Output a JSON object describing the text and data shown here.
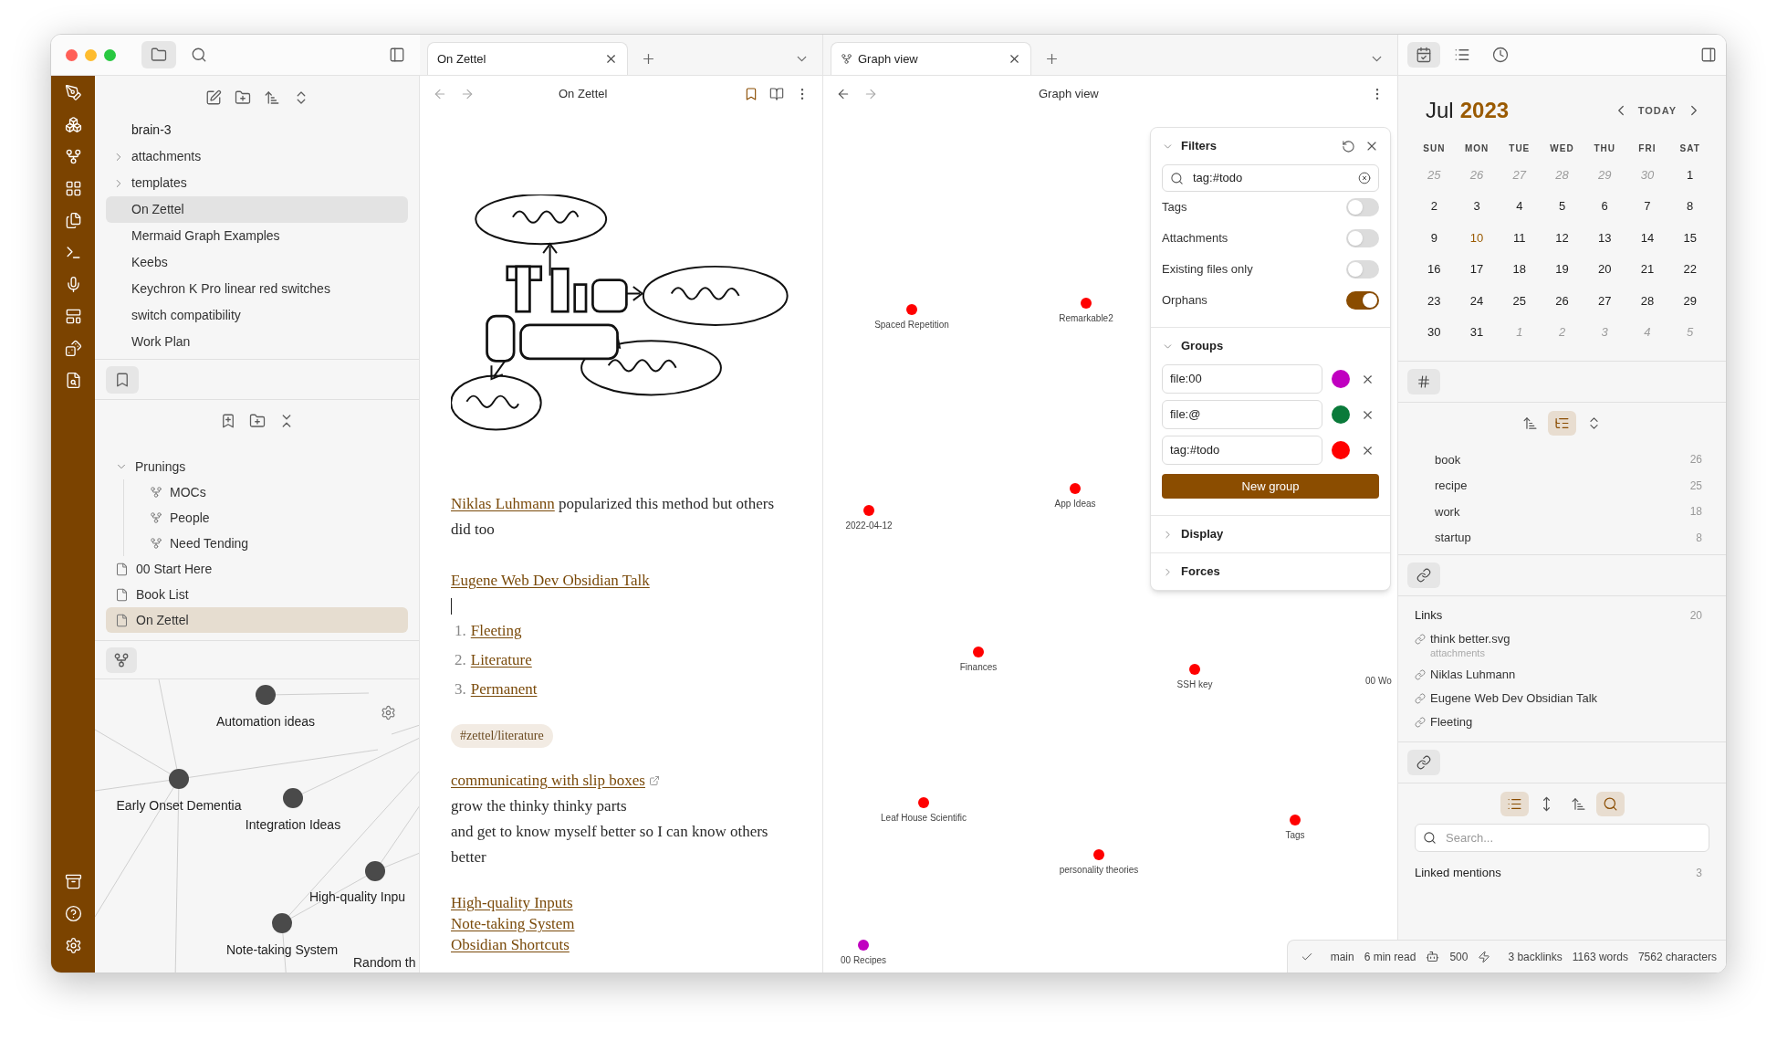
{
  "left_tabs": [
    {
      "kind": "files",
      "selected": true
    },
    {
      "kind": "search",
      "selected": false
    }
  ],
  "file_explorer": {
    "vault": "brain-3",
    "items": [
      {
        "label": "attachments",
        "kind": "folder",
        "selected": false
      },
      {
        "label": "templates",
        "kind": "folder",
        "selected": false
      },
      {
        "label": "On Zettel",
        "kind": "note",
        "selected": true
      },
      {
        "label": "Mermaid Graph Examples",
        "kind": "note",
        "selected": false
      },
      {
        "label": "Keebs",
        "kind": "note",
        "selected": false
      },
      {
        "label": "Keychron K Pro linear red switches",
        "kind": "note",
        "selected": false
      },
      {
        "label": "switch compatibility",
        "kind": "note",
        "selected": false
      },
      {
        "label": "Work Plan",
        "kind": "note",
        "selected": false
      }
    ]
  },
  "bookmarks": {
    "items": [
      {
        "label": "Prunings",
        "kind": "group",
        "selected": false,
        "expanded": true,
        "children": [
          {
            "label": "MOCs",
            "kind": "graph",
            "selected": false
          },
          {
            "label": "People",
            "kind": "graph",
            "selected": false
          },
          {
            "label": "Need Tending",
            "kind": "graph",
            "selected": false
          }
        ]
      },
      {
        "label": "00 Start Here",
        "kind": "note",
        "selected": false
      },
      {
        "label": "Book List",
        "kind": "note",
        "selected": false
      },
      {
        "label": "On Zettel",
        "kind": "note",
        "selected": true
      }
    ]
  },
  "local_graph": {
    "nodes": [
      {
        "label": "Automation ideas",
        "kind": "node"
      },
      {
        "label": "Early Onset Dementia",
        "kind": "node"
      },
      {
        "label": "Integration Ideas",
        "kind": "node"
      },
      {
        "label": "High-quality Inpu",
        "kind": "node"
      },
      {
        "label": "Note-taking System",
        "kind": "node"
      },
      {
        "label": "Random th",
        "kind": "label"
      }
    ]
  },
  "note": {
    "tab": "On Zettel",
    "title": "On Zettel",
    "blocks": [
      {
        "kind": "paragraph",
        "link": "Niklas Luhmann",
        "text": "popularized this method but others did too"
      },
      {
        "kind": "link",
        "text": "Eugene Web Dev Obsidian Talk"
      },
      {
        "kind": "cursor"
      },
      {
        "kind": "list",
        "items": [
          {
            "number": "1.",
            "text": "Fleeting"
          },
          {
            "number": "2.",
            "text": "Literature"
          },
          {
            "number": "3.",
            "text": "Permanent"
          }
        ]
      },
      {
        "kind": "tag",
        "text": "#zettel/literature"
      },
      {
        "kind": "external_link",
        "text": "communicating with slip boxes"
      },
      {
        "kind": "lines",
        "lines": [
          "grow the thinky thinky parts",
          "and get to know myself better so I can know others better"
        ]
      },
      {
        "kind": "links",
        "items": [
          "High-quality Inputs",
          "Note-taking System",
          "Obsidian Shortcuts"
        ]
      }
    ]
  },
  "graph": {
    "tab": "Graph view",
    "title": "Graph view",
    "nodes": [
      {
        "label": "Spaced Repetition",
        "color": "#ff0000"
      },
      {
        "label": "Remarkable2",
        "color": "#ff0000"
      },
      {
        "label": "App Ideas",
        "color": "#ff0000"
      },
      {
        "label": "2022-04-12",
        "color": "#ff0000"
      },
      {
        "label": "Finances",
        "color": "#ff0000"
      },
      {
        "label": "SSH key",
        "color": "#ff0000"
      },
      {
        "label": "00 Wo"
      },
      {
        "label": "Leaf House Scientific",
        "color": "#ff0000"
      },
      {
        "label": "Tags",
        "color": "#ff0000"
      },
      {
        "label": "personality theories",
        "color": "#ff0000"
      },
      {
        "label": "00 Recipes",
        "color": "#c000c0"
      }
    ],
    "filters": {
      "heading": {
        "label": "Filters",
        "expanded": true
      },
      "search": "tag:#todo",
      "toggles": [
        {
          "label": "Tags",
          "on": false
        },
        {
          "label": "Attachments",
          "on": false
        },
        {
          "label": "Existing files only",
          "on": false
        },
        {
          "label": "Orphans",
          "on": true
        }
      ],
      "groups_heading": {
        "label": "Groups",
        "expanded": true
      },
      "groups": [
        {
          "query": "file:00",
          "color": "#c000c0"
        },
        {
          "query": "file:@",
          "color": "#0a7a3a"
        },
        {
          "query": "tag:#todo",
          "color": "#ff0000"
        }
      ],
      "new_group": "New group",
      "sections": [
        {
          "label": "Display",
          "expanded": false
        },
        {
          "label": "Forces",
          "expanded": false
        }
      ]
    }
  },
  "right_tabs": [
    {
      "kind": "calendar",
      "selected": true
    },
    {
      "kind": "outline",
      "selected": false
    },
    {
      "kind": "recent",
      "selected": false
    }
  ],
  "calendar": {
    "month": "Jul",
    "year": "2023",
    "today_label": "TODAY",
    "weekdays": [
      "SUN",
      "MON",
      "TUE",
      "WED",
      "THU",
      "FRI",
      "SAT"
    ],
    "weeks": [
      [
        {
          "day": "25",
          "in_month": false,
          "today": false
        },
        {
          "day": "26",
          "in_month": false,
          "today": false
        },
        {
          "day": "27",
          "in_month": false,
          "today": false
        },
        {
          "day": "28",
          "in_month": false,
          "today": false
        },
        {
          "day": "29",
          "in_month": false,
          "today": false
        },
        {
          "day": "30",
          "in_month": false,
          "today": false
        },
        {
          "day": "1",
          "in_month": true,
          "today": false
        }
      ],
      [
        {
          "day": "2",
          "in_month": true,
          "today": false
        },
        {
          "day": "3",
          "in_month": true,
          "today": false
        },
        {
          "day": "4",
          "in_month": true,
          "today": false
        },
        {
          "day": "5",
          "in_month": true,
          "today": false
        },
        {
          "day": "6",
          "in_month": true,
          "today": false
        },
        {
          "day": "7",
          "in_month": true,
          "today": false
        },
        {
          "day": "8",
          "in_month": true,
          "today": false
        }
      ],
      [
        {
          "day": "9",
          "in_month": true,
          "today": false
        },
        {
          "day": "10",
          "in_month": true,
          "today": true
        },
        {
          "day": "11",
          "in_month": true,
          "today": false
        },
        {
          "day": "12",
          "in_month": true,
          "today": false
        },
        {
          "day": "13",
          "in_month": true,
          "today": false
        },
        {
          "day": "14",
          "in_month": true,
          "today": false
        },
        {
          "day": "15",
          "in_month": true,
          "today": false
        }
      ],
      [
        {
          "day": "16",
          "in_month": true,
          "today": false
        },
        {
          "day": "17",
          "in_month": true,
          "today": false
        },
        {
          "day": "18",
          "in_month": true,
          "today": false
        },
        {
          "day": "19",
          "in_month": true,
          "today": false
        },
        {
          "day": "20",
          "in_month": true,
          "today": false
        },
        {
          "day": "21",
          "in_month": true,
          "today": false
        },
        {
          "day": "22",
          "in_month": true,
          "today": false
        }
      ],
      [
        {
          "day": "23",
          "in_month": true,
          "today": false
        },
        {
          "day": "24",
          "in_month": true,
          "today": false
        },
        {
          "day": "25",
          "in_month": true,
          "today": false
        },
        {
          "day": "26",
          "in_month": true,
          "today": false
        },
        {
          "day": "27",
          "in_month": true,
          "today": false
        },
        {
          "day": "28",
          "in_month": true,
          "today": false
        },
        {
          "day": "29",
          "in_month": true,
          "today": false
        }
      ],
      [
        {
          "day": "30",
          "in_month": true,
          "today": false
        },
        {
          "day": "31",
          "in_month": true,
          "today": false
        },
        {
          "day": "1",
          "in_month": false,
          "today": false
        },
        {
          "day": "2",
          "in_month": false,
          "today": false
        },
        {
          "day": "3",
          "in_month": false,
          "today": false
        },
        {
          "day": "4",
          "in_month": false,
          "today": false
        },
        {
          "day": "5",
          "in_month": false,
          "today": false
        }
      ]
    ]
  },
  "tags": {
    "toolbar": [
      {
        "kind": "sort",
        "selected": false
      },
      {
        "kind": "tree",
        "selected": true
      },
      {
        "kind": "expand",
        "selected": false
      }
    ],
    "items": [
      {
        "name": "book",
        "count": "26"
      },
      {
        "name": "recipe",
        "count": "25"
      },
      {
        "name": "work",
        "count": "18"
      },
      {
        "name": "startup",
        "count": "8"
      }
    ]
  },
  "outgoing": {
    "title": "Links",
    "count": "20",
    "items": [
      {
        "name": "think better.svg",
        "folder": "attachments"
      },
      {
        "name": "Niklas Luhmann"
      },
      {
        "name": "Eugene Web Dev Obsidian Talk"
      },
      {
        "name": "Fleeting"
      }
    ]
  },
  "backlinks": {
    "toolbar": [
      {
        "kind": "list",
        "selected": true
      },
      {
        "kind": "expand",
        "selected": false
      },
      {
        "kind": "sort",
        "selected": false
      },
      {
        "kind": "search",
        "selected": true
      }
    ],
    "search_placeholder": "Search...",
    "title": "Linked mentions",
    "count": "3"
  },
  "status_bar": {
    "branch": "main",
    "read_time": "6 min read",
    "count": "500",
    "backlinks": "3 backlinks",
    "words": "1163 words",
    "characters": "7562 characters"
  }
}
